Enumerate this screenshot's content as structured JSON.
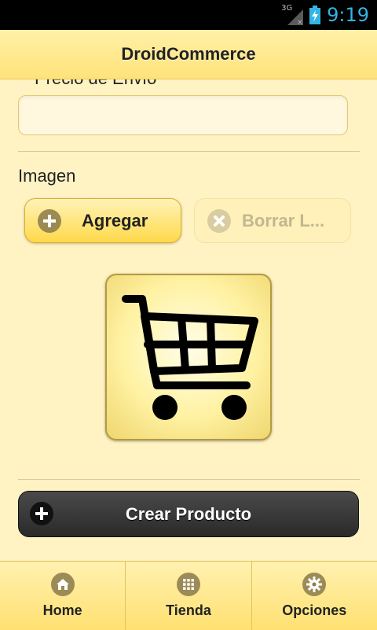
{
  "status": {
    "network": "3G",
    "time": "9:19"
  },
  "header": {
    "title": "DroidCommerce"
  },
  "form": {
    "cut_label": "Precio de Envío",
    "shipping_value": "",
    "image_label": "Imagen",
    "add_button": "Agregar",
    "delete_button": "Borrar L..."
  },
  "product_image": {
    "icon": "shopping-cart-icon"
  },
  "create_button": "Crear Producto",
  "tabs": [
    {
      "label": "Home",
      "icon": "home-icon"
    },
    {
      "label": "Tienda",
      "icon": "grid-icon"
    },
    {
      "label": "Opciones",
      "icon": "gear-icon"
    }
  ],
  "colors": {
    "accent": "#ffd94a",
    "dark_button": "#333333",
    "clock": "#33b5e5"
  }
}
